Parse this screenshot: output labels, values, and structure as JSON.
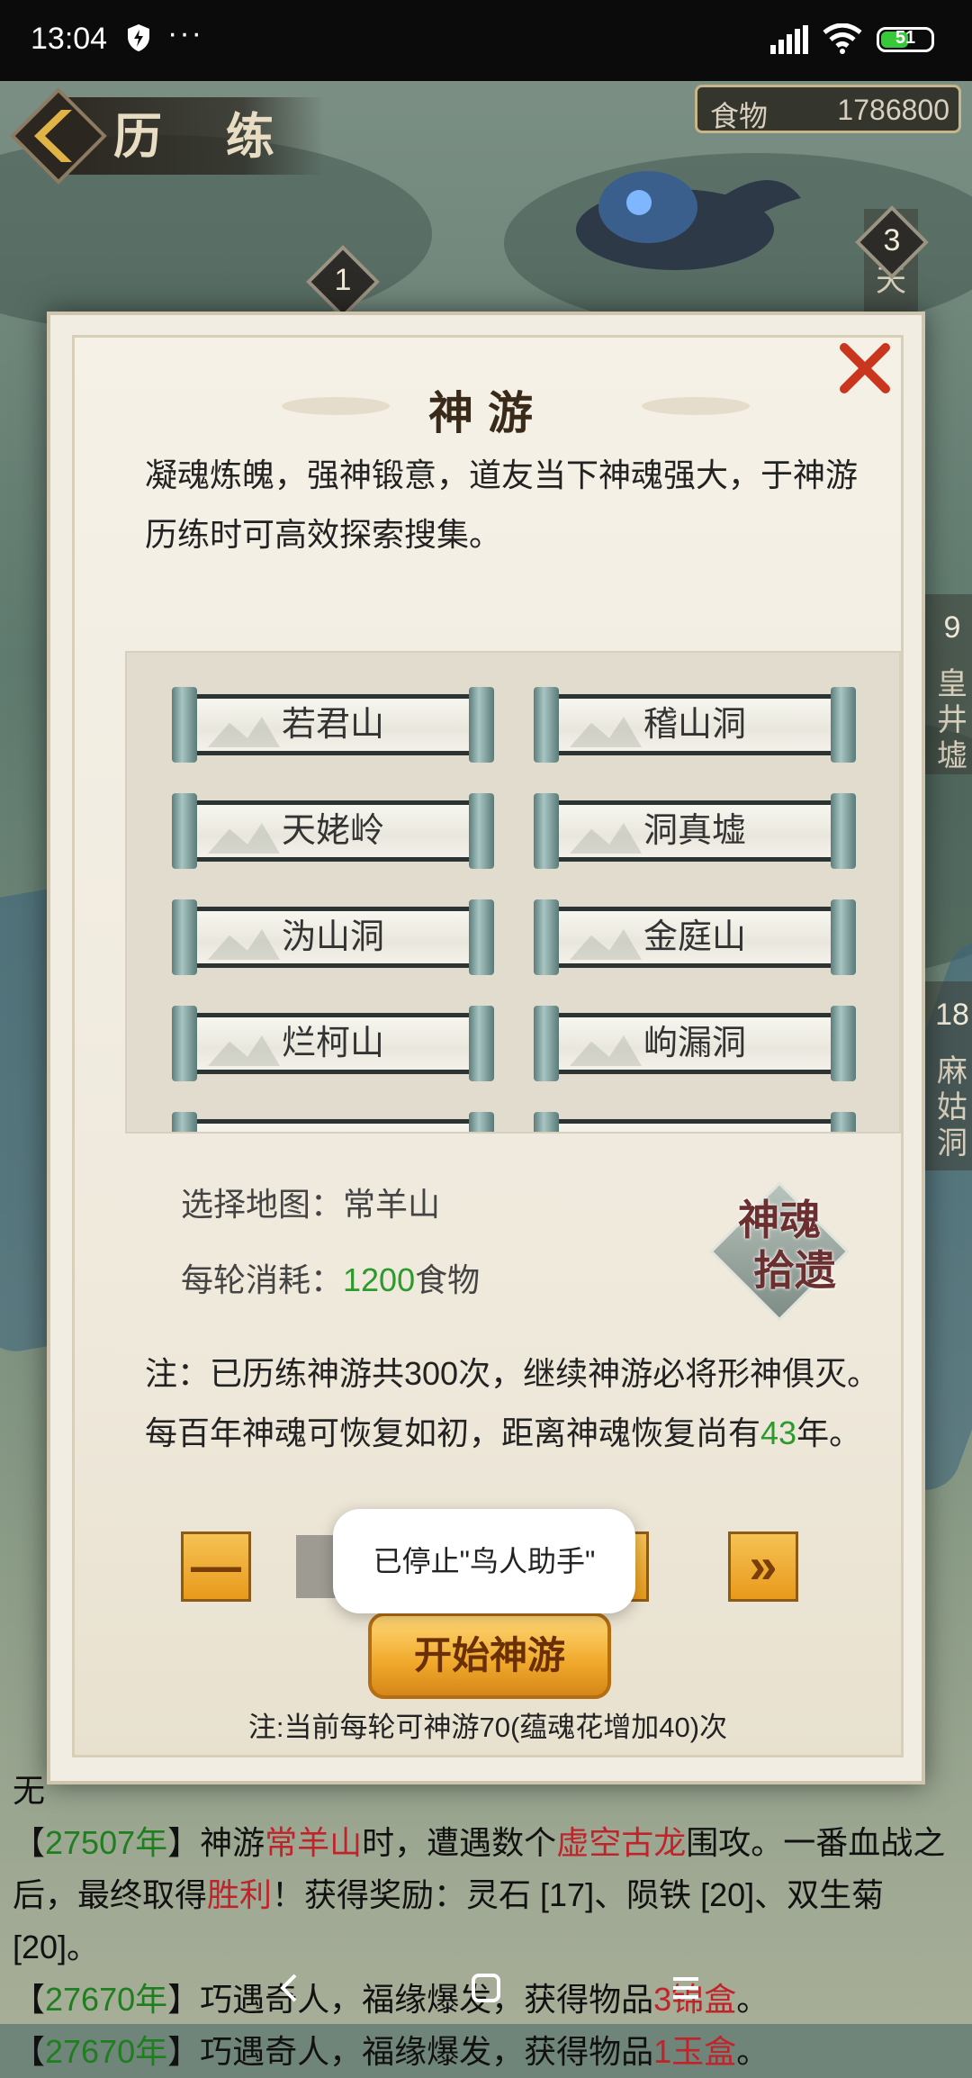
{
  "status_bar": {
    "time": "13:04",
    "battery": "51"
  },
  "header": {
    "title": "历 练",
    "food_label": "食物",
    "food_value": "1786800"
  },
  "map_nodes": [
    {
      "num": "1"
    },
    {
      "num": "3",
      "name": "天"
    },
    {
      "num": "9",
      "name": "皇井墟"
    },
    {
      "num": "18",
      "name": "麻姑洞"
    }
  ],
  "modal": {
    "title": "神游",
    "intro": "凝魂炼魄，强神锻意，道友当下神魂强大，于神游历练时可高效探索搜集。",
    "maps": [
      "若君山",
      "稽山洞",
      "天姥岭",
      "洞真墟",
      "沩山洞",
      "金庭山",
      "烂柯山",
      "岣漏洞"
    ],
    "select_label": "选择地图：",
    "select_value": "常羊山",
    "cost_label": "每轮消耗：",
    "cost_value": "1200",
    "cost_unit": "食物",
    "badge_line1": "神魂",
    "badge_line2": "拾遗",
    "note_text": "注：已历练神游共300次，继续神游必将形神俱灭。每百年神魂可恢复如初，距离神魂恢复尚有",
    "note_years": "43",
    "note_suffix": "年。",
    "minus_label": "—",
    "plus_label": "+",
    "max_label": "»",
    "start_label": "开始神游",
    "footnote": "注:当前每轮可神游70(蕴魂花增加40)次"
  },
  "toast": "已停止\"鸟人助手\"",
  "log": {
    "line0": "无",
    "entry1": {
      "year": "27507年",
      "pre": "神游",
      "place": "常羊山",
      "mid": "时，遭遇数个",
      "enemy": "虚空古龙",
      "post": "围攻。一番血战之后，最终取得",
      "result": "胜利",
      "reward": "！获得奖励：灵石 [17]、陨铁 [20]、双生菊 [20]。"
    },
    "entry2": {
      "year": "27670年",
      "text": "巧遇奇人，福缘爆发，获得物品",
      "item": "3锦盒",
      "end": "。"
    },
    "entry3": {
      "year": "27670年",
      "text": "巧遇奇人，福缘爆发，获得物品",
      "item": "1玉盒",
      "end": "。"
    }
  },
  "colors": {
    "green": "#2c9a2c",
    "red": "#c0232a",
    "gold": "#f0a82a"
  }
}
